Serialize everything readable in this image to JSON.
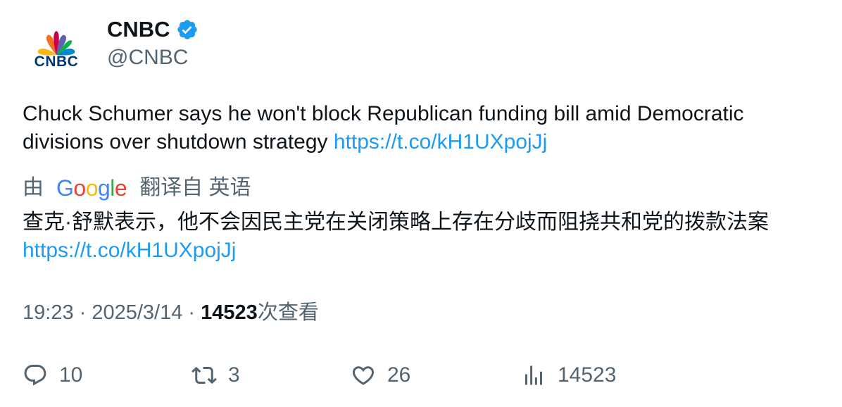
{
  "author": {
    "avatar_text": "CNBC",
    "display_name": "CNBC",
    "handle": "@CNBC",
    "verified_icon": "verified-badge-icon",
    "verified_color": "#1d9bf0"
  },
  "tweet": {
    "text": "Chuck Schumer says he won't block Republican funding bill amid Democratic divisions over shutdown strategy ",
    "link": "https://t.co/kH1UXpojJj"
  },
  "translation": {
    "prefix": "由",
    "provider": "Google",
    "suffix": "翻译自 英语",
    "text": "查克·舒默表示，他不会因民主党在关闭策略上存在分歧而阻挠共和党的拨款法案",
    "link": "https://t.co/kH1UXpojJj"
  },
  "meta": {
    "time": "19:23",
    "separator": " · ",
    "date": "2025/3/14",
    "views_count": "14523",
    "views_label": "次查看"
  },
  "actions": {
    "replies": "10",
    "retweets": "3",
    "likes": "26",
    "views": "14523"
  },
  "colors": {
    "link": "#1d9bf0",
    "secondary_text": "#536471",
    "primary_text": "#0f1419"
  }
}
